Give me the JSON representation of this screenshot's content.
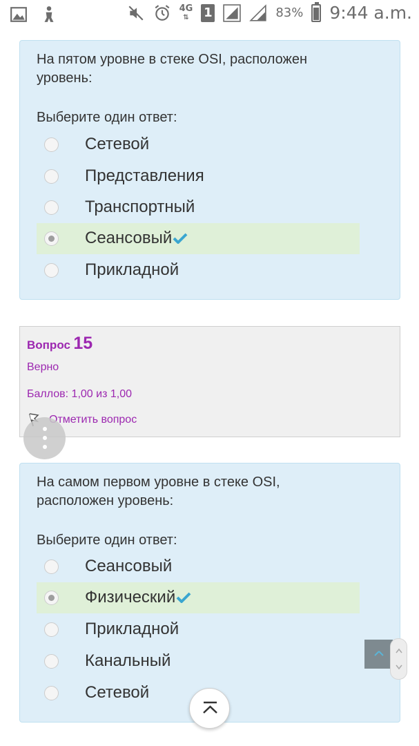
{
  "status_bar": {
    "network": "4G",
    "sim": "1",
    "battery": "83%",
    "time": "9:44 a.m."
  },
  "question_14": {
    "text": "На пятом уровне в стеке OSI, расположен уровень:",
    "prompt": "Выберите один ответ:",
    "options": [
      {
        "label": "Сетевой",
        "selected": false,
        "correct": false
      },
      {
        "label": "Представления",
        "selected": false,
        "correct": false
      },
      {
        "label": "Транспортный",
        "selected": false,
        "correct": false
      },
      {
        "label": "Сеансовый",
        "selected": true,
        "correct": true
      },
      {
        "label": "Прикладной",
        "selected": false,
        "correct": false
      }
    ]
  },
  "question_15_info": {
    "word": "Вопрос",
    "number": "15",
    "state": "Верно",
    "grade": "Баллов: 1,00 из 1,00",
    "flag_label": "Отметить вопрос"
  },
  "question_15": {
    "text": "На самом первом уровне в стеке OSI, расположен уровень:",
    "prompt": "Выберите один ответ:",
    "options": [
      {
        "label": "Сеансовый",
        "selected": false,
        "correct": false
      },
      {
        "label": "Физический",
        "selected": true,
        "correct": true
      },
      {
        "label": "Прикладной",
        "selected": false,
        "correct": false
      },
      {
        "label": "Канальный",
        "selected": false,
        "correct": false
      },
      {
        "label": "Сетевой",
        "selected": false,
        "correct": false
      }
    ]
  },
  "colors": {
    "question_bg": "#deeef8",
    "correct_bg": "#dff0d8",
    "accent_purple": "#9c27b0",
    "check_blue": "#3aa6d0"
  }
}
